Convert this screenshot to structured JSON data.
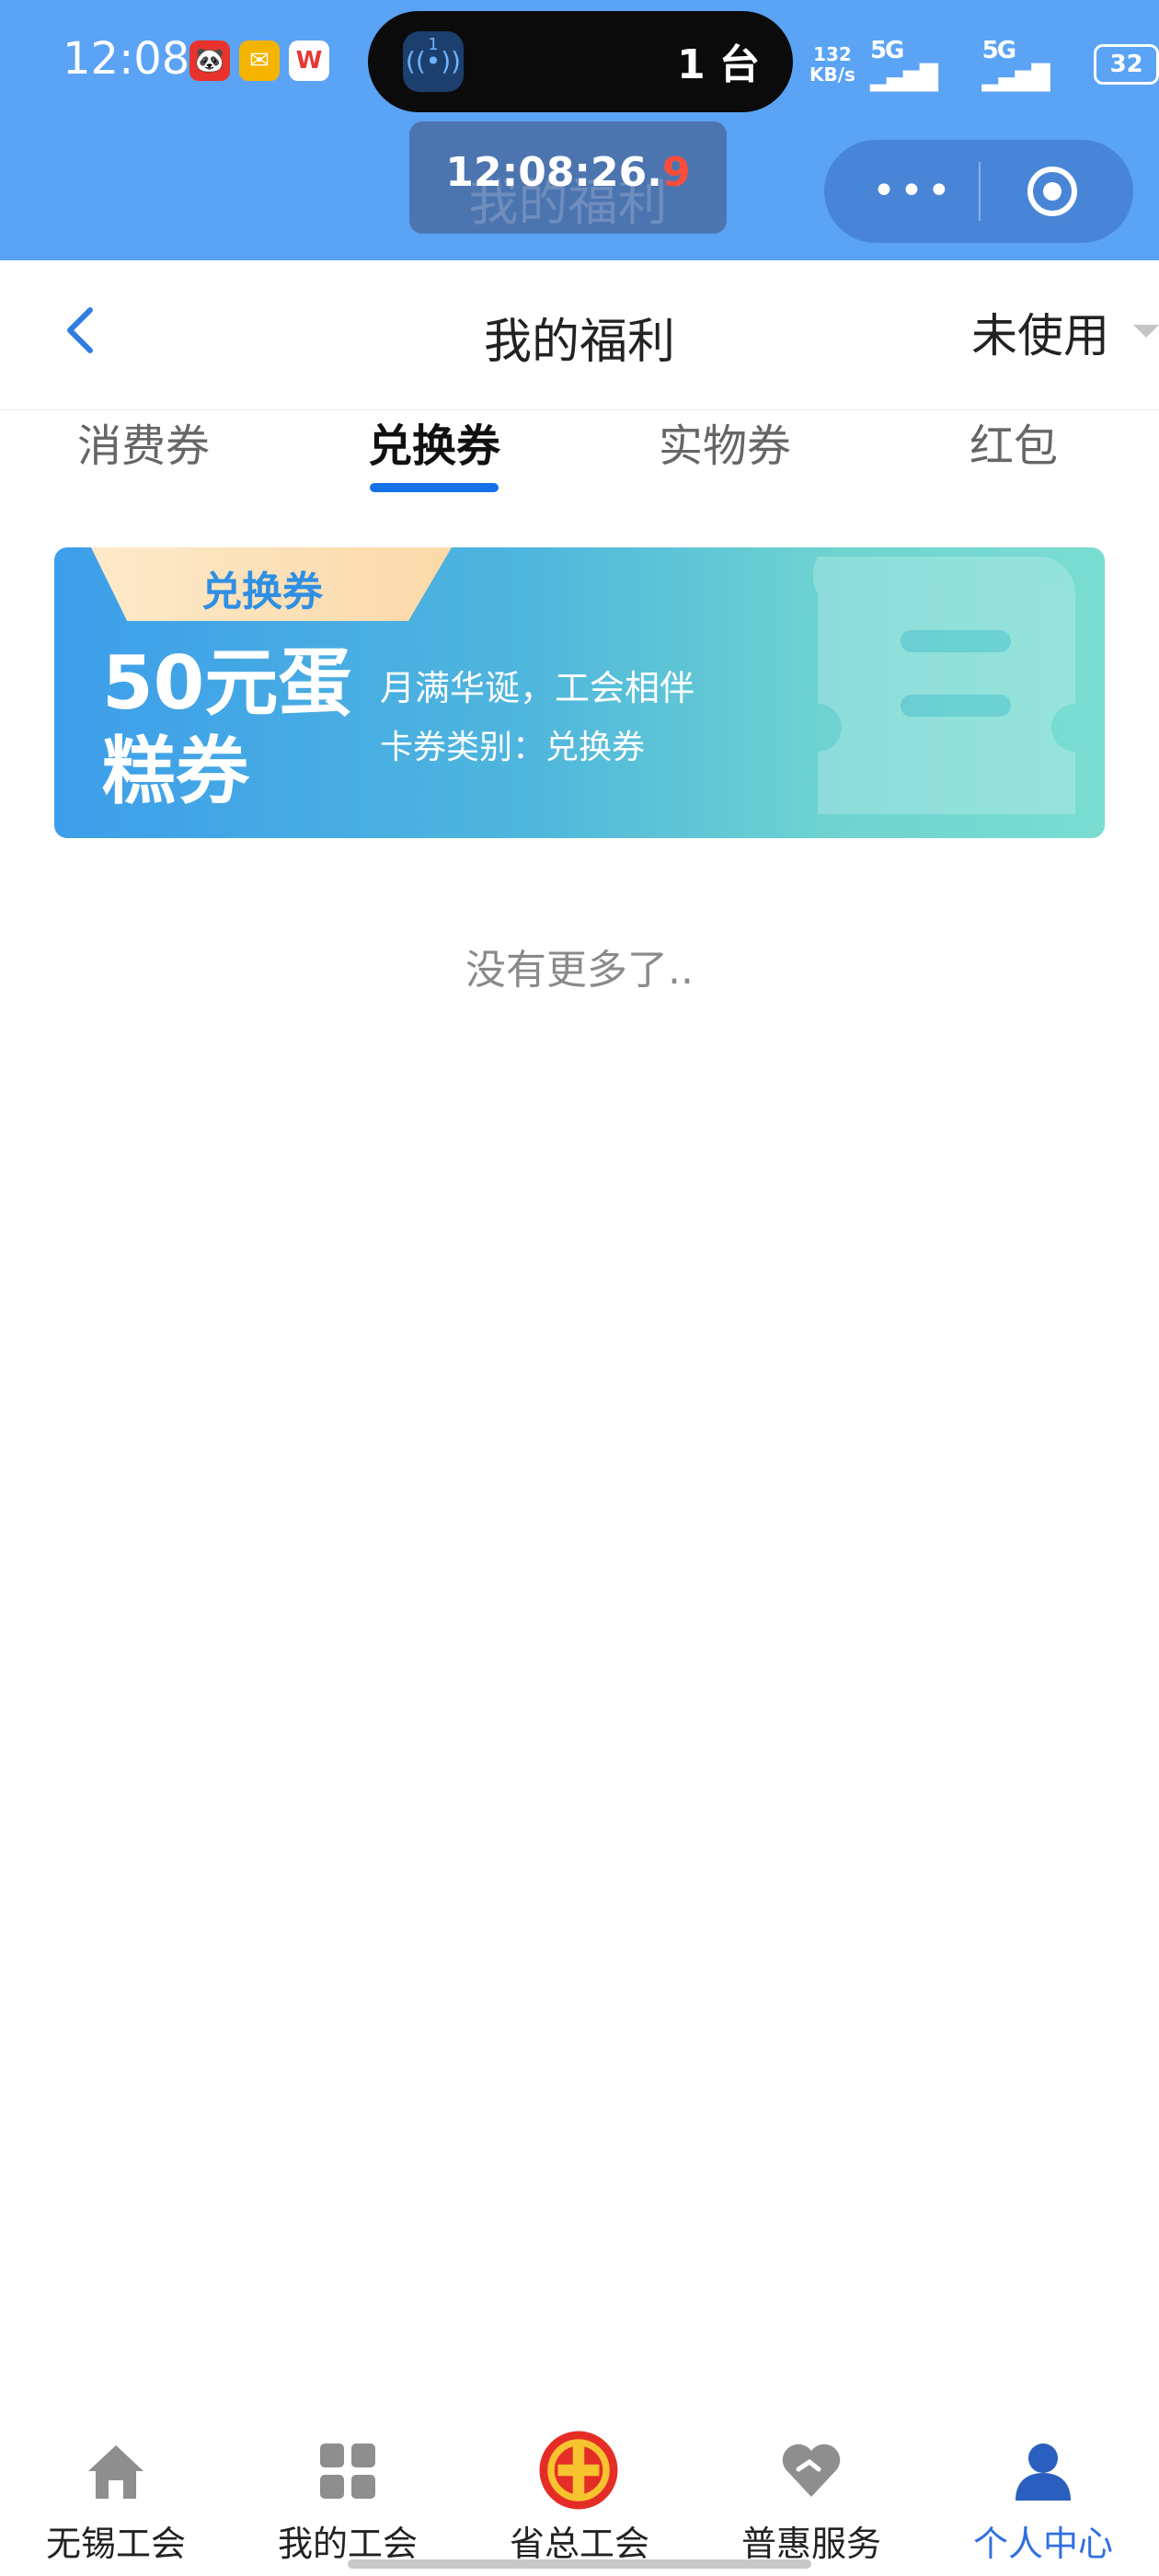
{
  "status_bar": {
    "time": "12:08",
    "island_badge": "1",
    "island_text": "1 台",
    "net_speed_value": "132",
    "net_speed_unit": "KB/s",
    "signal1": "5G",
    "signal2": "5G",
    "battery": "32"
  },
  "overlay": {
    "clock_main": "12:08:26.",
    "clock_red": "9",
    "ghost_title": "我的福利",
    "capsule_dots": "•••"
  },
  "header": {
    "title": "我的福利",
    "filter": "未使用"
  },
  "tabs": [
    {
      "label": "消费券",
      "active": false
    },
    {
      "label": "兑换券",
      "active": true
    },
    {
      "label": "实物券",
      "active": false
    },
    {
      "label": "红包",
      "active": false
    }
  ],
  "coupon": {
    "tag": "兑换券",
    "name": "50元蛋糕券",
    "description": "月满华诞，工会相伴",
    "type_line": "卡券类别：兑换券"
  },
  "list_end_text": "没有更多了..",
  "bottom_nav": [
    {
      "label": "无锡工会",
      "icon": "home-icon",
      "active": false
    },
    {
      "label": "我的工会",
      "icon": "grid-icon",
      "active": false
    },
    {
      "label": "省总工会",
      "icon": "union-emblem-icon",
      "active": false
    },
    {
      "label": "普惠服务",
      "icon": "heart-icon",
      "active": false
    },
    {
      "label": "个人中心",
      "icon": "person-icon",
      "active": true
    }
  ],
  "colors": {
    "topbar": "#5aa3f5",
    "accent": "#1670e8",
    "nav_active": "#2f6fe0"
  }
}
